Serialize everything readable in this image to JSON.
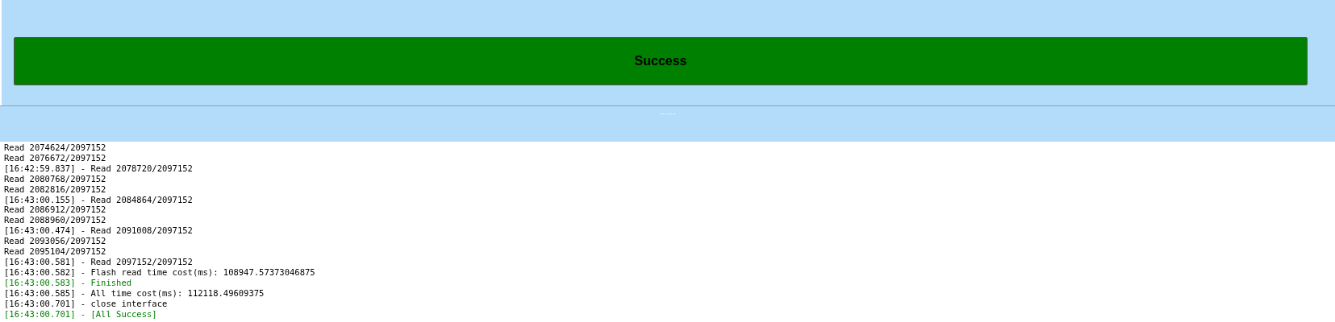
{
  "status_button": {
    "label": "Success"
  },
  "log": [
    {
      "kind": "normal",
      "text": "Read 2074624/2097152"
    },
    {
      "kind": "normal",
      "text": "Read 2076672/2097152"
    },
    {
      "kind": "normal",
      "text": "[16:42:59.837] - Read 2078720/2097152"
    },
    {
      "kind": "normal",
      "text": "Read 2080768/2097152"
    },
    {
      "kind": "normal",
      "text": "Read 2082816/2097152"
    },
    {
      "kind": "normal",
      "text": "[16:43:00.155] - Read 2084864/2097152"
    },
    {
      "kind": "normal",
      "text": "Read 2086912/2097152"
    },
    {
      "kind": "normal",
      "text": "Read 2088960/2097152"
    },
    {
      "kind": "normal",
      "text": "[16:43:00.474] - Read 2091008/2097152"
    },
    {
      "kind": "normal",
      "text": "Read 2093056/2097152"
    },
    {
      "kind": "normal",
      "text": "Read 2095104/2097152"
    },
    {
      "kind": "normal",
      "text": "[16:43:00.581] - Read 2097152/2097152"
    },
    {
      "kind": "normal",
      "text": "[16:43:00.582] - Flash read time cost(ms): 108947.57373046875"
    },
    {
      "kind": "success",
      "text": "[16:43:00.583] - Finished"
    },
    {
      "kind": "normal",
      "text": "[16:43:00.585] - All time cost(ms): 112118.49609375"
    },
    {
      "kind": "normal",
      "text": "[16:43:00.701] - close interface"
    },
    {
      "kind": "success",
      "text": "[16:43:00.701] - [All Success]"
    }
  ]
}
